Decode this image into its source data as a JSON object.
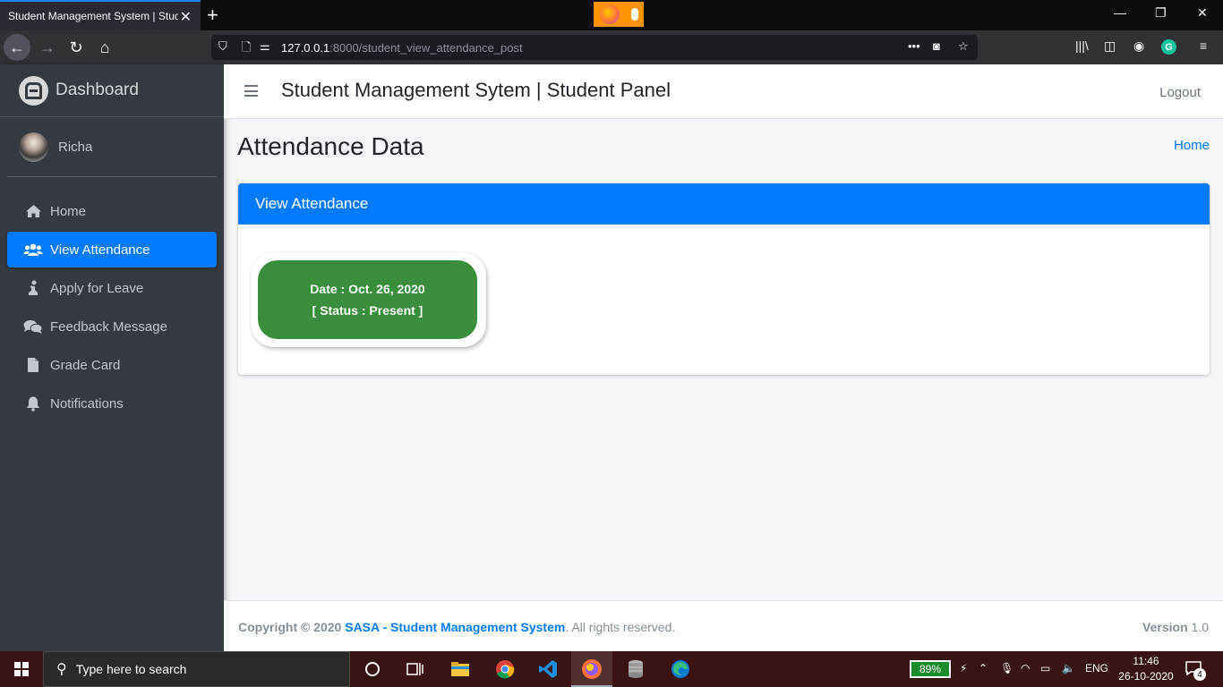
{
  "browser": {
    "tab_title": "Student Management System | Stud",
    "url_host": "127.0.0.1",
    "url_path": ":8000/student_view_attendance_post"
  },
  "sidebar": {
    "brand": "Dashboard",
    "user_name": "Richa",
    "items": [
      {
        "label": "Home",
        "icon": "home-icon",
        "active": false
      },
      {
        "label": "View Attendance",
        "icon": "users-icon",
        "active": true
      },
      {
        "label": "Apply for Leave",
        "icon": "person-praying-icon",
        "active": false
      },
      {
        "label": "Feedback Message",
        "icon": "comments-icon",
        "active": false
      },
      {
        "label": "Grade Card",
        "icon": "file-icon",
        "active": false
      },
      {
        "label": "Notifications",
        "icon": "bell-icon",
        "active": false
      }
    ]
  },
  "header": {
    "title": "Student Management Sytem | Student Panel",
    "logout": "Logout"
  },
  "page": {
    "title": "Attendance Data",
    "breadcrumb": "Home"
  },
  "card": {
    "title": "View Attendance",
    "records": [
      {
        "date": "Date : Oct. 26, 2020",
        "status": "[ Status : Present ]"
      }
    ]
  },
  "footer": {
    "copyright": "Copyright © 2020",
    "link": "SASA - Student Management System",
    "rights": ". All rights reserved.",
    "version_label": "Version",
    "version": "1.0"
  },
  "taskbar": {
    "search_placeholder": "Type here to search",
    "battery": "89%",
    "language": "ENG",
    "time": "11:46",
    "date": "26-10-2020",
    "notification_count": "4"
  },
  "colors": {
    "primary": "#007bff",
    "sidebar_bg": "#343a40",
    "present": "#388e3c"
  }
}
